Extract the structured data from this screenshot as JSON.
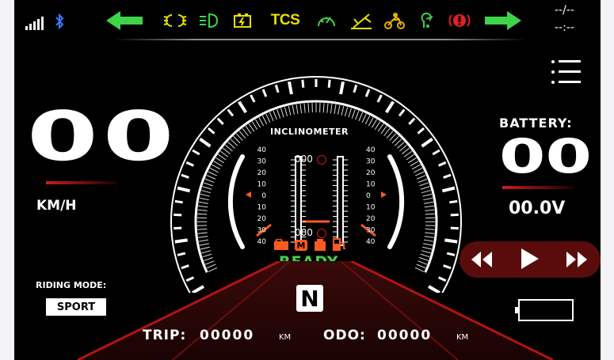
{
  "status": {
    "time_top": "--/--",
    "time_bottom": "--:--"
  },
  "indicators": [
    {
      "name": "left-turn-arrow-icon",
      "color": "#3fd34a"
    },
    {
      "name": "position-lights-icon",
      "color": "#e8e000"
    },
    {
      "name": "low-beam-icon",
      "color": "#3fd34a"
    },
    {
      "name": "battery-warning-icon",
      "color": "#e8e000"
    },
    {
      "name": "tcs-indicator",
      "label": "TCS",
      "color": "#e8e000"
    },
    {
      "name": "speedometer-warning-icon",
      "color": "#3fd34a"
    },
    {
      "name": "side-stand-icon",
      "color": "#e8e000"
    },
    {
      "name": "rider-icon",
      "color": "#e8b000"
    },
    {
      "name": "engine-check-icon",
      "color": "#3fd34a"
    },
    {
      "name": "abs-warning-icon",
      "color": "#e02020"
    },
    {
      "name": "right-turn-arrow-icon",
      "color": "#3fd34a"
    }
  ],
  "speed": {
    "value": "00",
    "unit": "KM/H"
  },
  "battery": {
    "label": "BATTERY:",
    "percent": "00",
    "voltage": "00.0V"
  },
  "inclinometer": {
    "label": "INCLINOMETER",
    "top_angle": "000",
    "bottom_angle": "000",
    "scale_left": [
      "40",
      "30",
      "20",
      "10",
      "0",
      "10",
      "20",
      "30",
      "40"
    ],
    "scale_right": [
      "40",
      "30",
      "20",
      "10",
      "0",
      "10",
      "20",
      "30",
      "40"
    ]
  },
  "ready_text": "READY",
  "riding_mode": {
    "label": "RIDING MODE:",
    "value": "SPORT"
  },
  "gear": "N",
  "trip": {
    "label": "TRIP:",
    "value": "00000",
    "unit": "KM"
  },
  "odo": {
    "label": "ODO:",
    "value": "00000",
    "unit": "KM"
  },
  "colors": {
    "accent_red": "#d11a1a",
    "ready_green": "#3fd34a",
    "warning_orange": "#ff5a1f"
  }
}
